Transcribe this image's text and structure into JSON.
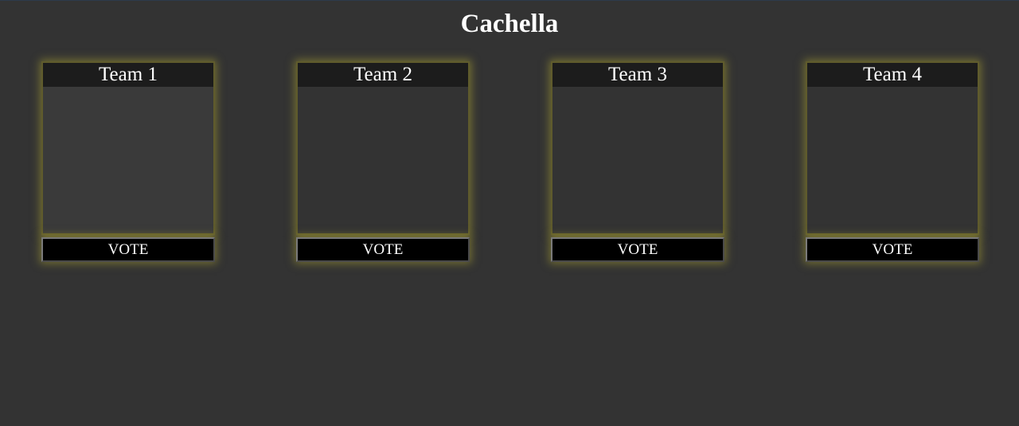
{
  "page": {
    "title": "Cachella"
  },
  "teams": [
    {
      "name": "Team 1",
      "vote_label": "VOTE"
    },
    {
      "name": "Team 2",
      "vote_label": "VOTE"
    },
    {
      "name": "Team 3",
      "vote_label": "VOTE"
    },
    {
      "name": "Team 4",
      "vote_label": "VOTE"
    }
  ],
  "colors": {
    "background": "#333333",
    "header": "#1c1c1c",
    "button": "#000000",
    "glow": "#aaa032",
    "text": "#ffffff"
  }
}
